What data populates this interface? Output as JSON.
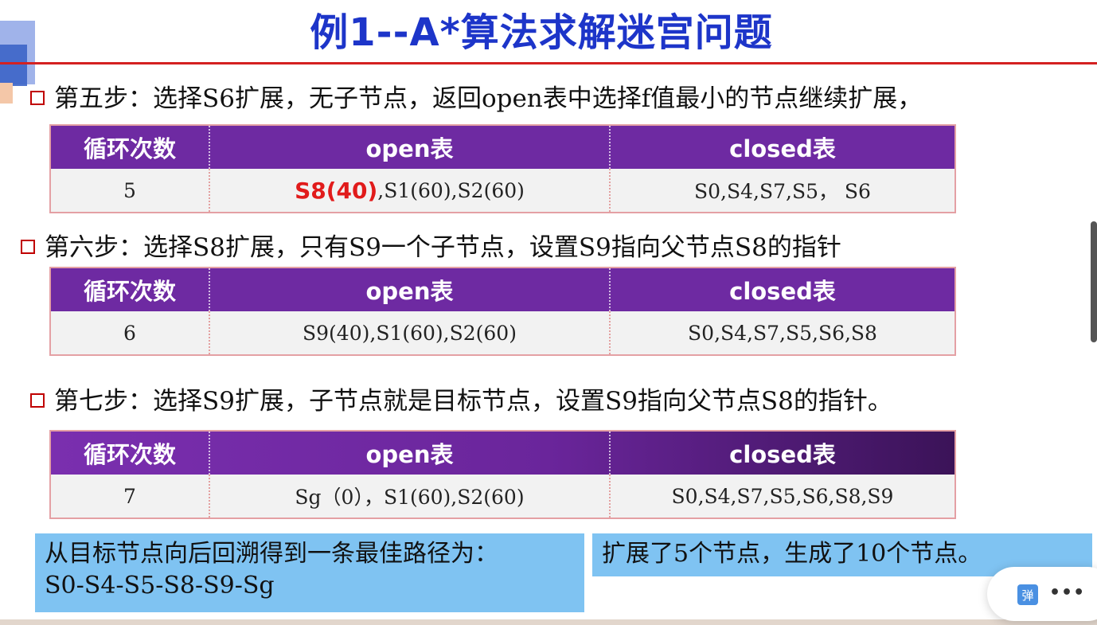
{
  "title": "例1--A*算法求解迷宫问题",
  "steps": [
    {
      "text": "第五步：选择S6扩展，无子节点，返回open表中选择f值最小的节点继续扩展，"
    },
    {
      "text": "第六步：选择S8扩展，只有S9一个子节点，设置S9指向父节点S8的指针"
    },
    {
      "text": "第七步：选择S9扩展，子节点就是目标节点，设置S9指向父节点S8的指针。"
    }
  ],
  "table_headers": {
    "loop": "循环次数",
    "open": "open表",
    "closed": "closed表"
  },
  "tables": [
    {
      "loop": "5",
      "open_highlight": "S8(40)",
      "open_rest": ",S1(60),S2(60)",
      "closed": "S0,S4,S7,S5， S6"
    },
    {
      "loop": "6",
      "open": "S9(40),S1(60),S2(60)",
      "closed": "S0,S4,S7,S5,S6,S8"
    },
    {
      "loop": "7",
      "open": "Sg（0），S1(60),S2(60)",
      "closed": "S0,S4,S7,S5,S6,S8,S9"
    }
  ],
  "conclusion": {
    "path_line1": "从目标节点向后回溯得到一条最佳路径为：",
    "path_line2": "S0-S4-S5-S8-S9-Sg",
    "summary": "扩展了5个节点，生成了10个节点。"
  },
  "floating_toolbar": {
    "danmu_label": "弹",
    "more_label": "•••"
  },
  "colors": {
    "title": "#1d35c9",
    "header_bg": "#6e2aa2",
    "highlight": "#e11b1b",
    "box_bg": "#7fc3f2",
    "rule": "#d42121"
  }
}
